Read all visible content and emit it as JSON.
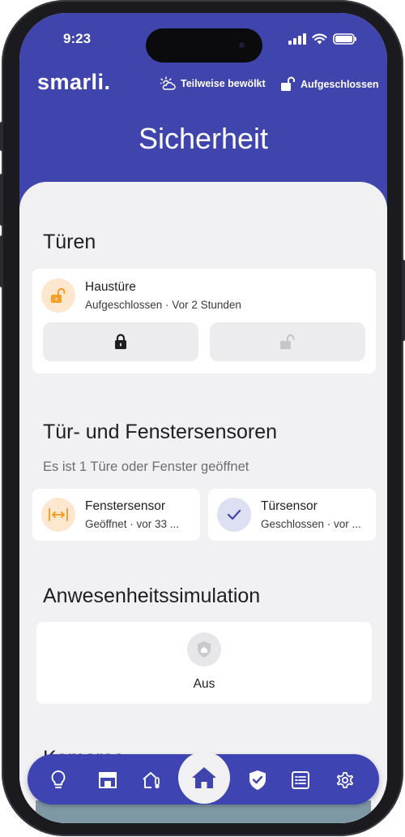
{
  "status_bar": {
    "time": "9:23"
  },
  "header": {
    "brand": "smarli.",
    "weather": "Teilweise bewölkt",
    "lock_state": "Aufgeschlossen",
    "title": "Sicherheit"
  },
  "doors": {
    "title": "Türen",
    "item": {
      "name": "Haustüre",
      "state": "Aufgeschlossen · Vor 2 Stunden",
      "icon": "lock-open-icon"
    },
    "lock_button_icon": "lock-icon",
    "unlock_button_icon": "lock-open-icon"
  },
  "sensors": {
    "title": "Tür- und Fenstersensoren",
    "subtitle": "Es ist 1 Türe oder Fenster geöffnet",
    "items": [
      {
        "name": "Fenstersensor",
        "state": "Geöffnet · vor 33 ...",
        "icon": "window-open-icon"
      },
      {
        "name": "Türsensor",
        "state": "Geschlossen · vor ...",
        "icon": "check-icon"
      }
    ]
  },
  "presence": {
    "title": "Anwesenheitssimulation",
    "state": "Aus",
    "icon": "home-shield-icon"
  },
  "cameras": {
    "title": "Kameras"
  },
  "nav": {
    "items": [
      "bulb-icon",
      "store-icon",
      "home-thermometer-icon",
      "home-icon",
      "shield-check-icon",
      "list-icon",
      "gear-icon"
    ],
    "active": "home-icon"
  },
  "colors": {
    "primary": "#3f45ad",
    "orange": "#f4a02a",
    "orange_bg": "#fde7cf",
    "purple_bg": "#dddff2",
    "background": "#f1f1f3"
  }
}
